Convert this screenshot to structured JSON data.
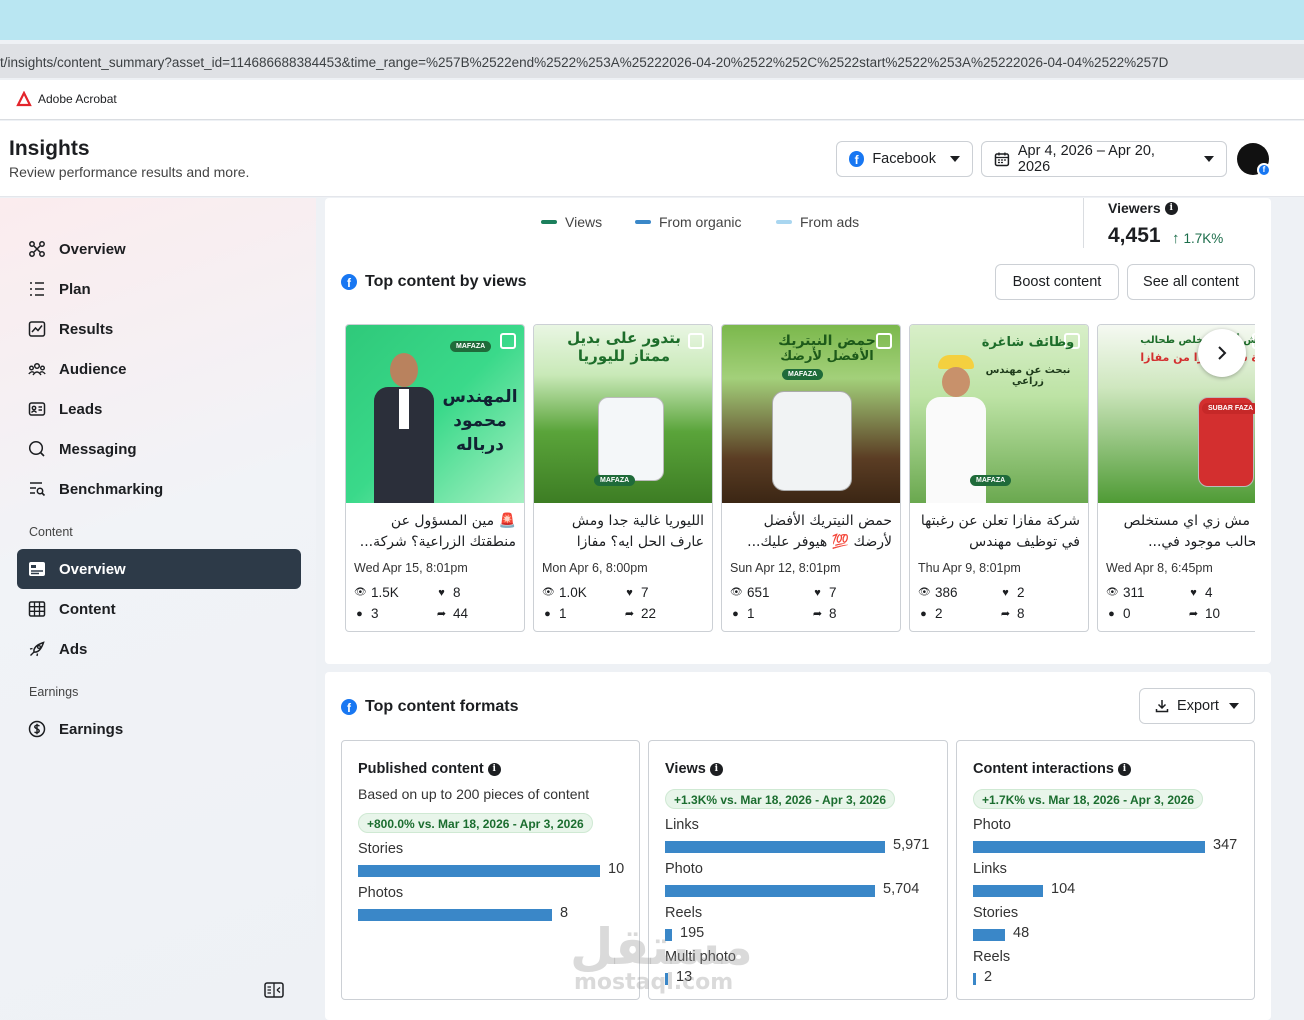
{
  "browser": {
    "url": "t/insights/content_summary?asset_id=114686688384453&time_range=%257B%2522end%2522%253A%25222026-04-20%2522%252C%2522start%2522%253A%25222026-04-04%2522%257D",
    "bookmark": "Adobe Acrobat"
  },
  "header": {
    "title": "Insights",
    "subtitle": "Review performance results and more.",
    "platform": "Facebook",
    "date_range": "Apr 4, 2026 – Apr 20, 2026"
  },
  "sidebar": {
    "items": [
      {
        "label": "Overview",
        "icon": "overview-icon"
      },
      {
        "label": "Plan",
        "icon": "plan-icon"
      },
      {
        "label": "Results",
        "icon": "results-icon"
      },
      {
        "label": "Audience",
        "icon": "audience-icon"
      },
      {
        "label": "Leads",
        "icon": "leads-icon"
      },
      {
        "label": "Messaging",
        "icon": "messaging-icon"
      },
      {
        "label": "Benchmarking",
        "icon": "benchmarking-icon"
      }
    ],
    "content_section": "Content",
    "content_items": [
      {
        "label": "Overview",
        "icon": "overview-card-icon",
        "active": true
      },
      {
        "label": "Content",
        "icon": "content-grid-icon"
      },
      {
        "label": "Ads",
        "icon": "rocket-icon"
      }
    ],
    "earnings_section": "Earnings",
    "earnings_items": [
      {
        "label": "Earnings",
        "icon": "dollar-icon"
      }
    ]
  },
  "legend": {
    "views": "Views",
    "organic": "From organic",
    "ads": "From ads",
    "colors": {
      "views": "#1b7f5c",
      "organic": "#3a87c8",
      "ads": "#a9d6f0"
    }
  },
  "viewers": {
    "label": "Viewers",
    "value": "4,451",
    "delta": "1.7K%"
  },
  "top_content": {
    "title": "Top content by views",
    "boost": "Boost content",
    "see_all": "See all content",
    "posts": [
      {
        "caption": "🚨 مين المسؤول عن منطقتك الزراعية؟ شركة...",
        "date": "Wed Apr 15, 8:01pm",
        "views": "1.5K",
        "reactions": "8",
        "comments": "3",
        "shares": "44",
        "thumb_text": [
          "المهندس",
          "محمود",
          "درباله"
        ],
        "logo": "MAFAZA"
      },
      {
        "caption": "الليوريا غالية جدا ومش عارف الحل ايه؟ مفازا دايما...",
        "date": "Mon Apr 6, 8:00pm",
        "views": "1.0K",
        "reactions": "7",
        "comments": "1",
        "shares": "22",
        "thumb_text": [
          "بتدور على بديل",
          "ممتاز لليوريا"
        ],
        "logo": "MAFAZA"
      },
      {
        "caption": "حمض النيتريك الأفضل لأرضك 💯 هيوفر عليك...",
        "date": "Sun Apr 12, 8:01pm",
        "views": "651",
        "reactions": "7",
        "comments": "1",
        "shares": "8",
        "thumb_text": [
          "حمض النيتريك",
          "الأفضل لأرضك"
        ],
        "logo": "MAFAZA"
      },
      {
        "caption": "شركة مفازا تعلن عن رغبتها في توظيف مهندس زراعي...",
        "date": "Thu Apr 9, 8:01pm",
        "views": "386",
        "reactions": "2",
        "comments": "2",
        "shares": "8",
        "thumb_text": [
          "وظائف شاغرة",
          "نبحث عن مهندس زراعي"
        ],
        "logo": "MAFAZA"
      },
      {
        "caption": "دة مش زي اي مستخلص طحالب موجود في...",
        "date": "Wed Apr 8, 6:45pm",
        "views": "311",
        "reactions": "4",
        "comments": "0",
        "shares": "10",
        "thumb_text": [
          "مش أي مستخلص طحالب",
          "دة سوبر فازا من مفازا"
        ],
        "logo": "SUBAR FAZA"
      }
    ]
  },
  "formats": {
    "title": "Top content formats",
    "export": "Export",
    "published": {
      "title": "Published content",
      "subtitle": "Based on up to 200 pieces of content",
      "pill": "+800.0% vs. Mar 18, 2026 - Apr 3, 2026",
      "rows": [
        {
          "label": "Stories",
          "value": "10",
          "n": 10
        },
        {
          "label": "Photos",
          "value": "8",
          "n": 8
        }
      ],
      "max": 10
    },
    "views": {
      "title": "Views",
      "pill": "+1.3K% vs. Mar 18, 2026 - Apr 3, 2026",
      "rows": [
        {
          "label": "Links",
          "value": "5,971",
          "n": 5971
        },
        {
          "label": "Photo",
          "value": "5,704",
          "n": 5704
        },
        {
          "label": "Reels",
          "value": "195",
          "n": 195
        },
        {
          "label": "Multi photo",
          "value": "13",
          "n": 13
        }
      ],
      "max": 5971
    },
    "interactions": {
      "title": "Content interactions",
      "pill": "+1.7K% vs. Mar 18, 2026 - Apr 3, 2026",
      "rows": [
        {
          "label": "Photo",
          "value": "347",
          "n": 347
        },
        {
          "label": "Links",
          "value": "104",
          "n": 104
        },
        {
          "label": "Stories",
          "value": "48",
          "n": 48
        },
        {
          "label": "Reels",
          "value": "2",
          "n": 2
        }
      ],
      "max": 347
    }
  },
  "watermark": {
    "arabic": "مستقل",
    "latin": "mostaql.com"
  }
}
